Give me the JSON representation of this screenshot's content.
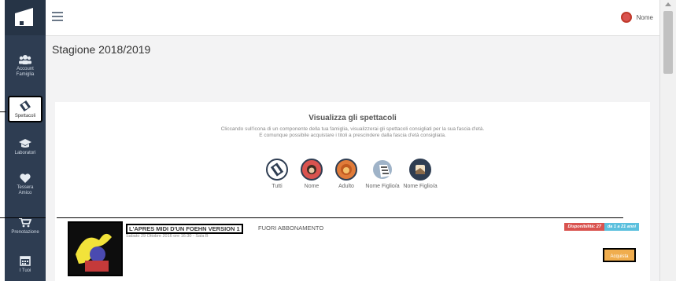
{
  "sidebar": {
    "items": [
      {
        "label": "Account\nFamiglia",
        "icon": "users-icon"
      },
      {
        "label": "Spettacoli",
        "icon": "tickets-icon"
      },
      {
        "label": "Laboratori",
        "icon": "graduation-cap-icon"
      },
      {
        "label": "Tessera\nAmico",
        "icon": "heart-icon"
      },
      {
        "label": "Prenotazione",
        "icon": "cart-icon"
      },
      {
        "label": "I Tuoi",
        "icon": "calendar-icon"
      }
    ]
  },
  "header": {
    "user_name": "Nome"
  },
  "main": {
    "page_title": "Stagione 2018/2019",
    "card_title": "Visualizza gli spettacoli",
    "card_desc_1": "Cliccando sull'icona di un componente della tua famiglia, visualizzerai gli spettacoli consigliati per la sua fascia d'età.",
    "card_desc_2": "E comunque possibile acquistare i titoli a prescindere dalla fascia d'età consigliata.",
    "choices": [
      "Tutti",
      "Nome",
      "Adulto",
      "Nome Figlio/a",
      "Nome Figlio/a"
    ],
    "show": {
      "title": "L'APRES MIDI D'UN FOEHN VERSION 1",
      "subtitle": "FUORI ABBONAMENTO",
      "date": "Sabato 29 Ottobre 2016 ore 16:30 - Sala B",
      "availability": "Disponibilità: 27",
      "age": "da 1 a 21 anni",
      "buy_label": "Acquista"
    }
  },
  "colors": {
    "sidebar": "#2e3d52",
    "accent_orange": "#f0ad4e",
    "badge_red": "#d9534f",
    "badge_blue": "#5bc0de"
  }
}
